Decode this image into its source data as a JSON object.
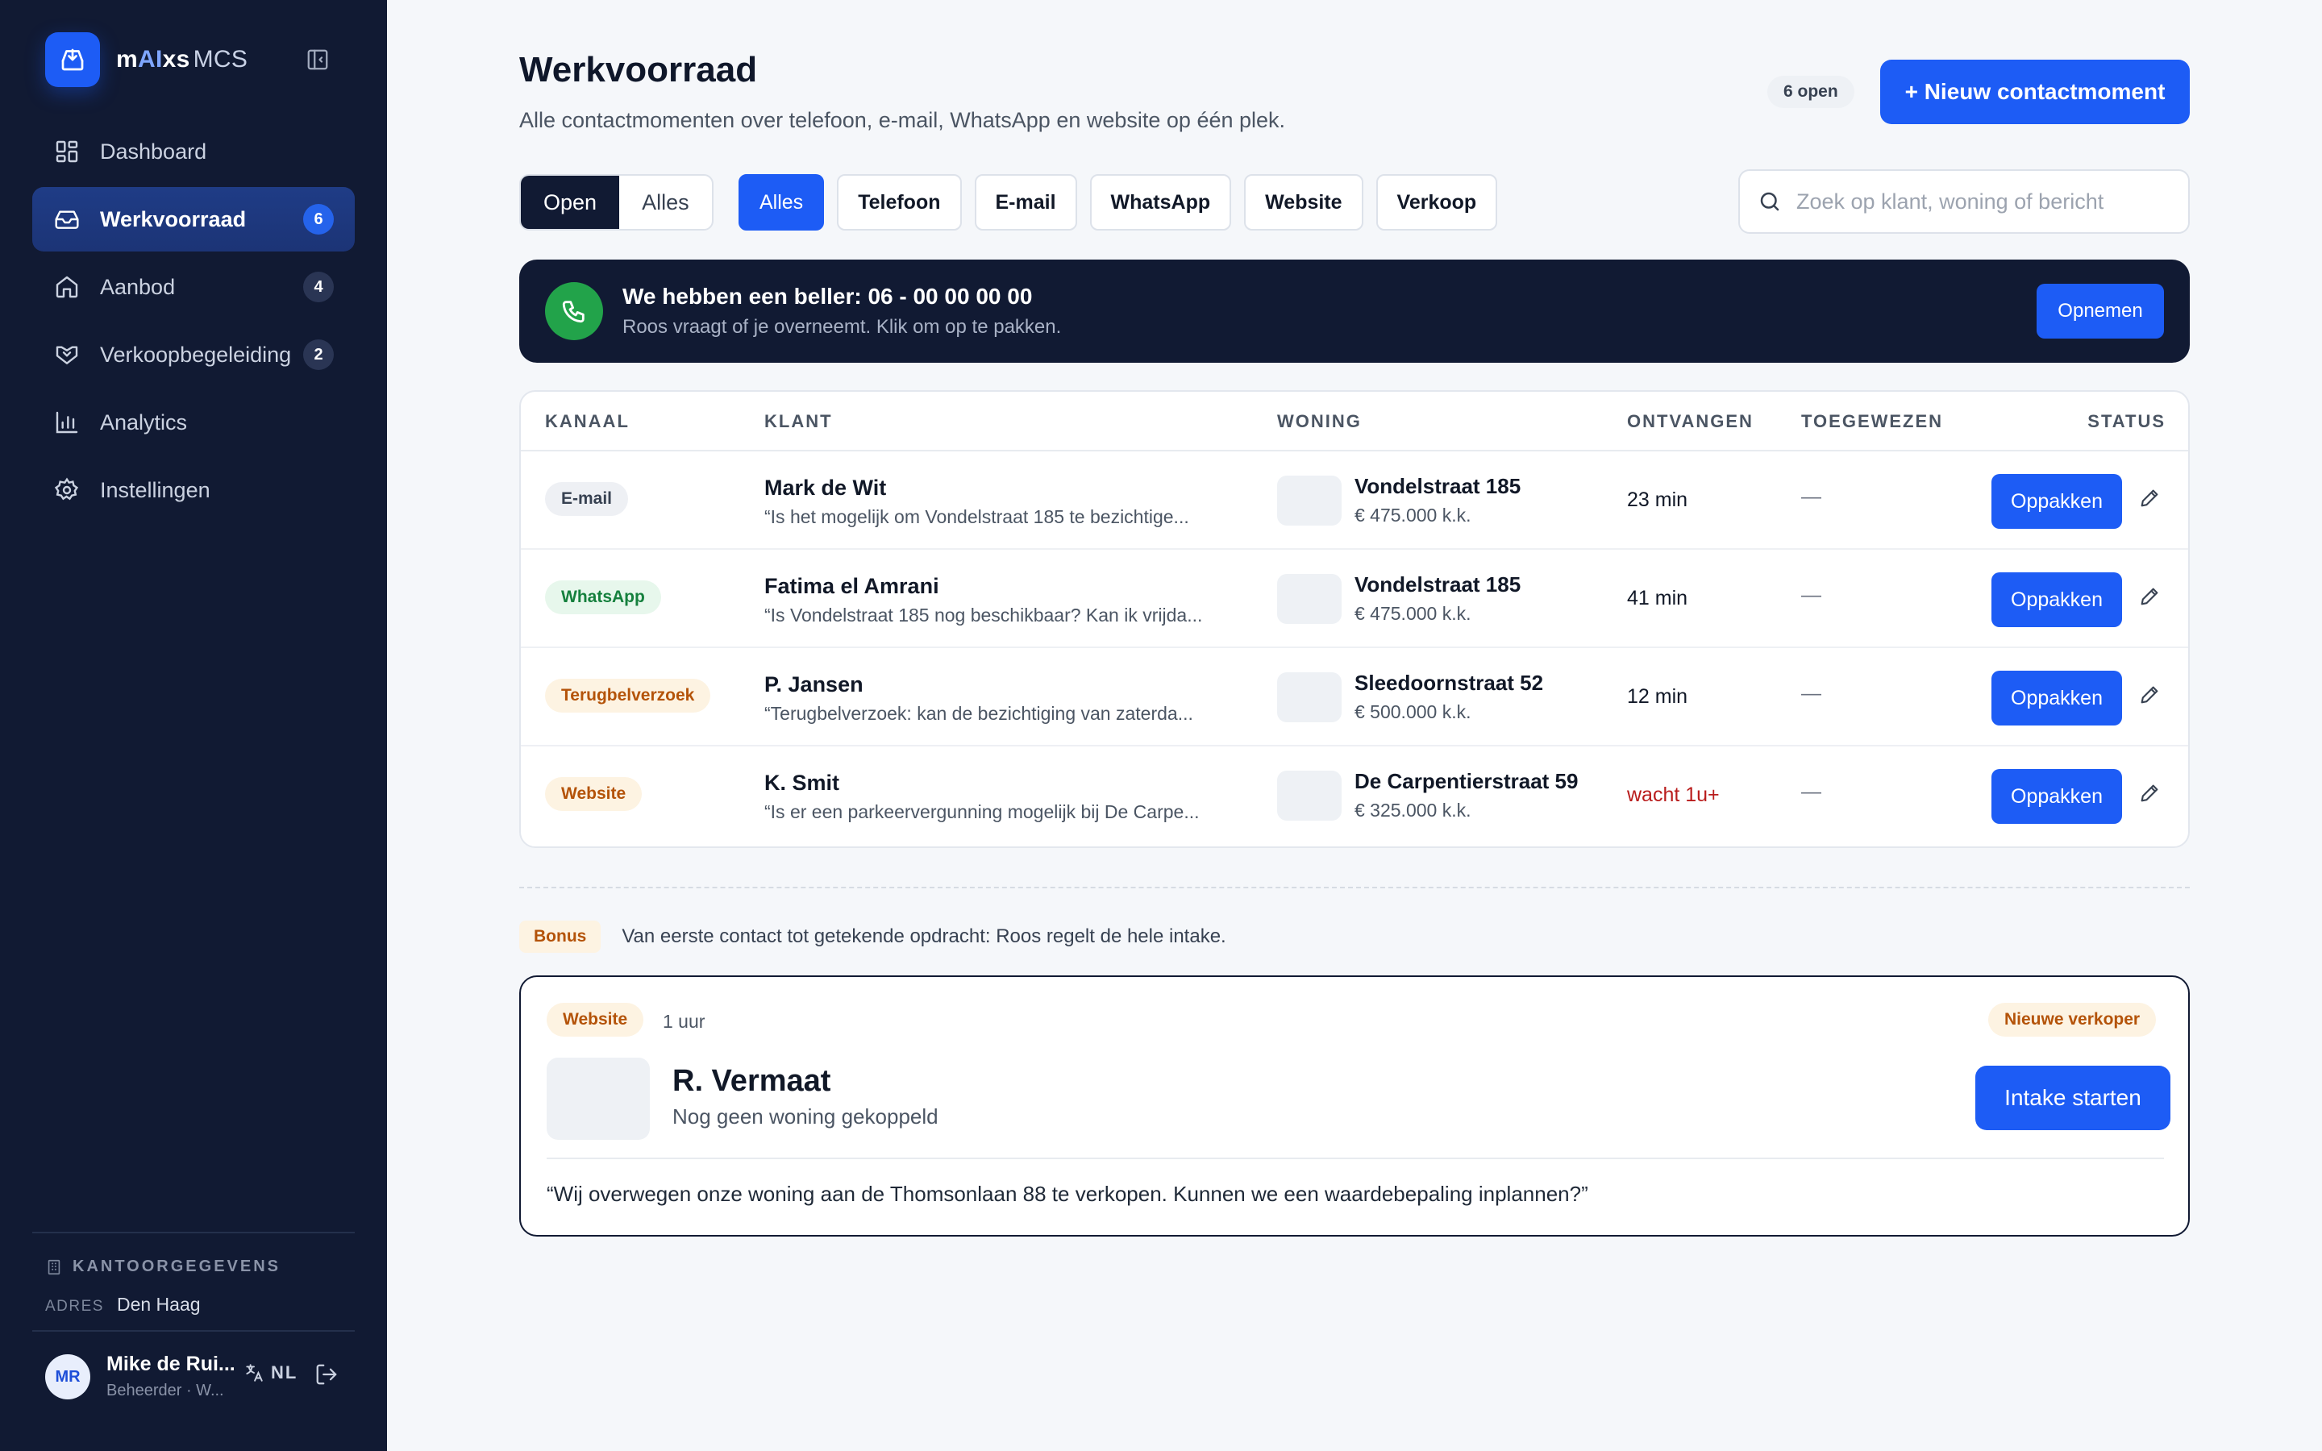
{
  "app": {
    "logo_m": "m",
    "logo_ai": "AI",
    "logo_xs": "xs",
    "logo_mcs": "MCS"
  },
  "sidebar": {
    "items": [
      {
        "label": "Dashboard",
        "icon": "grid-icon",
        "badge": ""
      },
      {
        "label": "Werkvoorraad",
        "icon": "inbox-icon",
        "badge": "6"
      },
      {
        "label": "Aanbod",
        "icon": "home-icon",
        "badge": "4"
      },
      {
        "label": "Verkoopbegeleiding",
        "icon": "handshake-icon",
        "badge": "2"
      },
      {
        "label": "Analytics",
        "icon": "bar-chart-icon",
        "badge": ""
      },
      {
        "label": "Instellingen",
        "icon": "gear-icon",
        "badge": ""
      }
    ],
    "office_heading": "KANTOORGEGEVENS",
    "office_label": "ADRES",
    "office_value": "Den Haag",
    "user_initials": "MR",
    "user_name": "Mike de Rui...",
    "user_role": "Beheerder · W...",
    "lang": "NL"
  },
  "header": {
    "title": "Werkvoorraad",
    "subtitle": "Alle contactmomenten over telefoon, e-mail, WhatsApp en website op één plek.",
    "open_count": "6 open",
    "new_button": "+ Nieuw contactmoment"
  },
  "filters": {
    "segment": [
      "Open",
      "Alles"
    ],
    "channels": [
      "Alles",
      "Telefoon",
      "E-mail",
      "WhatsApp",
      "Website",
      "Verkoop"
    ],
    "search_placeholder": "Zoek op klant, woning of bericht"
  },
  "call": {
    "title": "We hebben een beller: 06 - 00 00 00 00",
    "subtitle": "Roos vraagt of je overneemt. Klik om op te pakken.",
    "button": "Opnemen"
  },
  "table": {
    "headers": [
      "KANAAL",
      "KLANT",
      "WONING",
      "ONTVANGEN",
      "TOEGEWEZEN",
      "STATUS"
    ],
    "action_label": "Oppakken",
    "rows": [
      {
        "channel": "E-mail",
        "name": "Mark de Wit",
        "message": "“Is het mogelijk om Vondelstraat 185 te bezichtige...",
        "address": "Vondelstraat 185",
        "price": "€ 475.000 k.k.",
        "received": "23 min",
        "assigned": "—"
      },
      {
        "channel": "WhatsApp",
        "name": "Fatima el Amrani",
        "message": "“Is Vondelstraat 185 nog beschikbaar? Kan ik vrijda...",
        "address": "Vondelstraat 185",
        "price": "€ 475.000 k.k.",
        "received": "41 min",
        "assigned": "—"
      },
      {
        "channel": "Terugbelverzoek",
        "name": "P. Jansen",
        "message": "“Terugbelverzoek: kan de bezichtiging van zaterda...",
        "address": "Sleedoornstraat 52",
        "price": "€ 500.000 k.k.",
        "received": "12 min",
        "assigned": "—"
      },
      {
        "channel": "Website",
        "name": "K. Smit",
        "message": "“Is er een parkeervergunning mogelijk bij De Carpe...",
        "address": "De Carpentierstraat 59",
        "price": "€ 325.000 k.k.",
        "received": "wacht 1u+",
        "assigned": "—"
      }
    ]
  },
  "bonus": {
    "badge": "Bonus",
    "text": "Van eerste contact tot getekende opdracht: Roos regelt de hele intake."
  },
  "lead": {
    "channel": "Website",
    "time": "1 uur",
    "tag": "Nieuwe verkoper",
    "name": "R. Vermaat",
    "subtitle": "Nog geen woning gekoppeld",
    "button": "Intake starten",
    "quote": "“Wij overwegen onze woning aan de Thomsonlaan 88 te verkopen. Kunnen we een waardebepaling inplannen?”"
  },
  "colors": {
    "accent": "#1d5cf5",
    "sidebar": "#111a33",
    "success": "#22a34a",
    "warning": "#b45309",
    "danger": "#b91c1c"
  }
}
